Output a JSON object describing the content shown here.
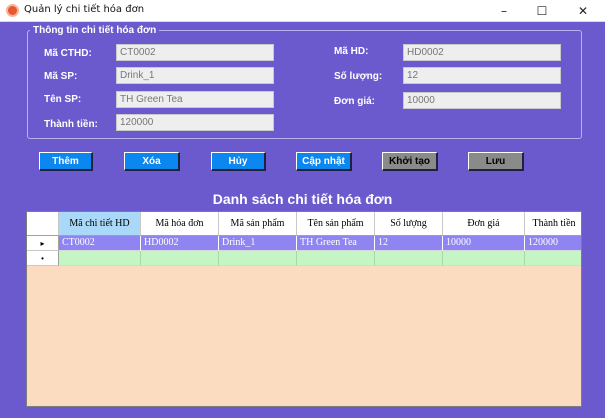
{
  "window": {
    "title": "Quản lý chi tiết hóa đơn",
    "minimize": "–",
    "maximize": "☐",
    "close": "✕"
  },
  "info_group": {
    "title": "Thông tin chi tiết hóa đơn",
    "ma_cthd_label": "Mã CTHD:",
    "ma_cthd_value": "CT0002",
    "ma_sp_label": "Mã SP:",
    "ma_sp_value": "Drink_1",
    "ten_sp_label": "Tên SP:",
    "ten_sp_value": "TH Green Tea",
    "thanh_tien_label": "Thành tiền:",
    "thanh_tien_value": "120000",
    "ma_hd_label": "Mã HD:",
    "ma_hd_value": "HD0002",
    "so_luong_label": "Số lượng:",
    "so_luong_value": "12",
    "don_gia_label": "Đơn giá:",
    "don_gia_value": "10000"
  },
  "buttons": {
    "them": "Thêm",
    "xoa": "Xóa",
    "huy": "Hủy",
    "cap_nhat": "Cập nhật",
    "khoi_tao": "Khởi tạo",
    "luu": "Lưu"
  },
  "list": {
    "title": "Danh sách chi tiết hóa đơn",
    "columns": [
      "Mã chi tiết HD",
      "Mã hóa đơn",
      "Mã sản phẩm",
      "Tên sản phẩm",
      "Số lượng",
      "Đơn giá",
      "Thành tiền"
    ],
    "rows": [
      [
        "CT0002",
        "HD0002",
        "Drink_1",
        "TH Green Tea",
        "12",
        "10000",
        "120000"
      ]
    ],
    "current_row_marker": "▸",
    "new_row_marker": "•"
  },
  "colors": {
    "background": "#6a5acd",
    "button_blue": "#0d87f0",
    "button_gray": "#8a8a8a",
    "grid_background": "#fcdcc0",
    "data_row": "#8f85f2",
    "new_row": "#c4f5c4",
    "selected_header": "#a9d8f8"
  }
}
